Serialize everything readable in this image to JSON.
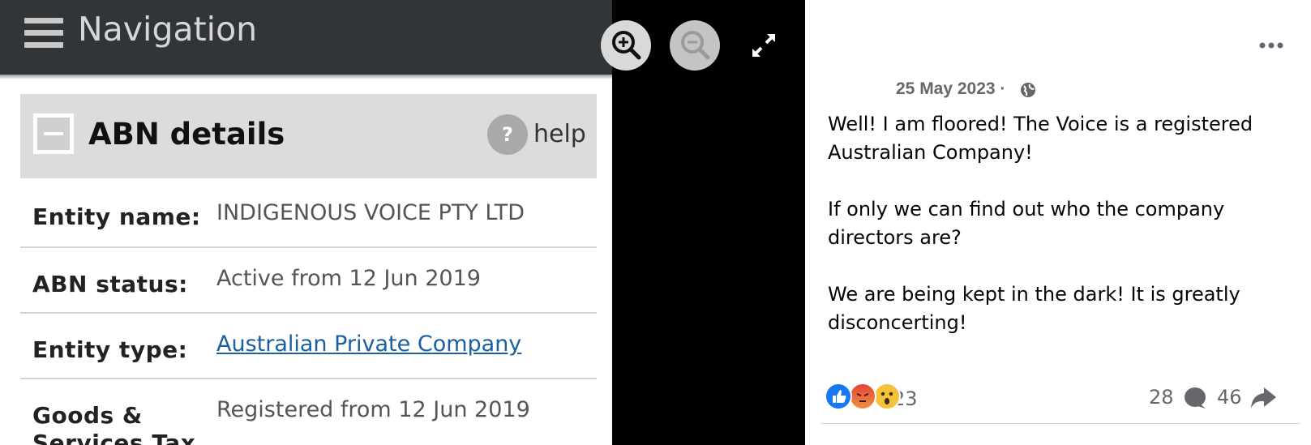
{
  "viewer": {
    "zoom_in_icon": "zoom-in-icon",
    "zoom_out_icon": "zoom-out-icon",
    "expand_icon": "expand-icon"
  },
  "photo": {
    "nav": {
      "title": "Navigation",
      "menu_icon": "hamburger-icon"
    },
    "section": {
      "title": "ABN details",
      "help_label": "help",
      "help_symbol": "?"
    },
    "rows": [
      {
        "label": "Entity name:",
        "value": "INDIGENOUS VOICE PTY LTD"
      },
      {
        "label": "ABN status:",
        "value": "Active from 12 Jun 2019"
      },
      {
        "label": "Entity type:",
        "value": "Australian Private Company"
      },
      {
        "label": "Goods &\nServices Tax",
        "value": "Registered from 12 Jun 2019"
      }
    ]
  },
  "post": {
    "date": "25 May 2023 ·",
    "privacy_icon": "globe-icon",
    "paragraphs": [
      "Well! I am floored! The Voice is a registered Australian Company!",
      "If only we can find out who the company directors are?",
      "We are being kept in the dark! It is greatly disconcerting!"
    ],
    "reactions": [
      "like",
      "angry",
      "wow"
    ],
    "reaction_count": "23",
    "comment_count": "28",
    "share_count": "46",
    "colors": {
      "like": "#1877f2",
      "link": "#1a5fa0",
      "navbar": "#313538"
    }
  }
}
